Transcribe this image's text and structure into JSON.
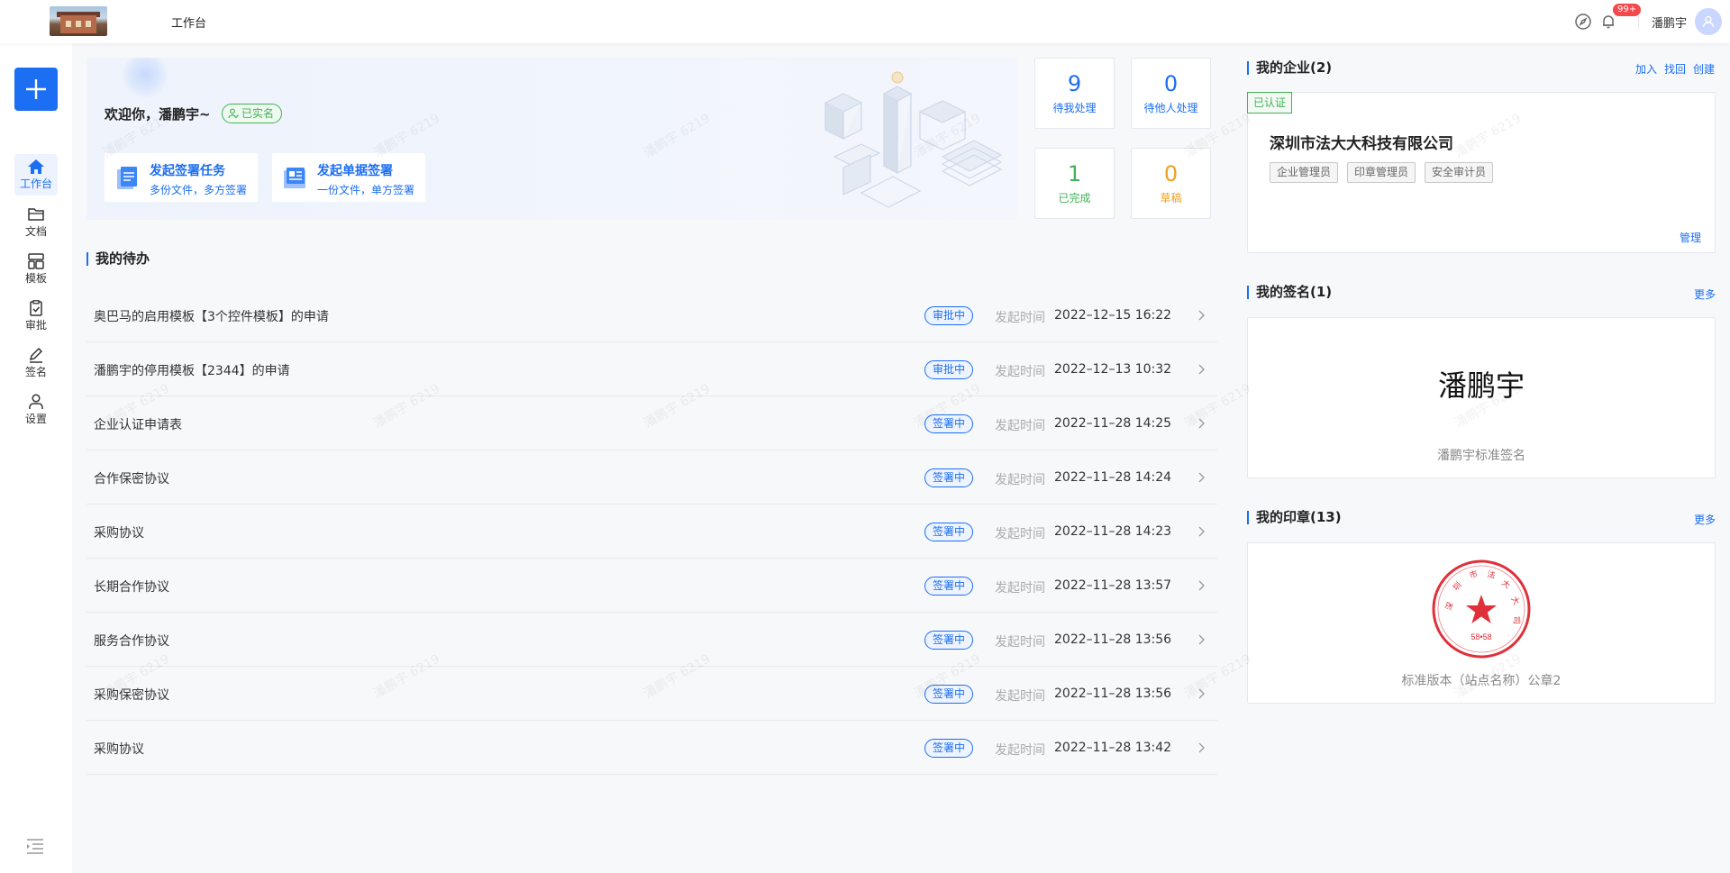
{
  "header": {
    "title": "工作台",
    "notification_badge": "99+",
    "username": "潘鹏宇"
  },
  "sidebar": {
    "items": [
      {
        "label": "工作台",
        "icon": "home-icon",
        "active": true
      },
      {
        "label": "文档",
        "icon": "folder-icon"
      },
      {
        "label": "模板",
        "icon": "template-icon"
      },
      {
        "label": "审批",
        "icon": "approval-icon"
      },
      {
        "label": "签名",
        "icon": "pen-icon"
      },
      {
        "label": "设置",
        "icon": "user-settings-icon"
      }
    ]
  },
  "banner": {
    "welcome": "欢迎你，潘鹏宇~",
    "verified": "已实名",
    "actions": [
      {
        "title": "发起签署任务",
        "subtitle": "多份文件，多方签署"
      },
      {
        "title": "发起单据签署",
        "subtitle": "一份文件，单方签署"
      }
    ]
  },
  "stats": [
    {
      "value": "9",
      "label": "待我处理",
      "color": "#1c6ef2"
    },
    {
      "value": "0",
      "label": "待他人处理",
      "color": "#1c6ef2"
    },
    {
      "value": "1",
      "label": "已完成",
      "color": "#43b257"
    },
    {
      "value": "0",
      "label": "草稿",
      "color": "#f0a020"
    }
  ],
  "todo": {
    "title": "我的待办",
    "time_label": "发起时间",
    "items": [
      {
        "name": "奥巴马的启用模板【3个控件模板】的申请",
        "status": "审批中",
        "time": "2022–12–15 16:22"
      },
      {
        "name": "潘鹏宇的停用模板【2344】的申请",
        "status": "审批中",
        "time": "2022–12–13 10:32"
      },
      {
        "name": "企业认证申请表",
        "status": "签署中",
        "time": "2022–11–28 14:25"
      },
      {
        "name": "合作保密协议",
        "status": "签署中",
        "time": "2022–11–28 14:24"
      },
      {
        "name": "采购协议",
        "status": "签署中",
        "time": "2022–11–28 14:23"
      },
      {
        "name": "长期合作协议",
        "status": "签署中",
        "time": "2022–11–28 13:57"
      },
      {
        "name": "服务合作协议",
        "status": "签署中",
        "time": "2022–11–28 13:56"
      },
      {
        "name": "采购保密协议",
        "status": "签署中",
        "time": "2022–11–28 13:56"
      },
      {
        "name": "采购协议",
        "status": "签署中",
        "time": "2022–11–28 13:42"
      }
    ]
  },
  "enterprise": {
    "title": "我的企业(2)",
    "links": [
      "加入",
      "找回",
      "创建"
    ],
    "cert": "已认证",
    "company": "深圳市法大大科技有限公司",
    "roles": [
      "企业管理员",
      "印章管理员",
      "安全审计员"
    ],
    "manage": "管理"
  },
  "signature": {
    "title": "我的签名(1)",
    "more": "更多",
    "name": "潘鹏宇",
    "caption": "潘鹏宇标准签名"
  },
  "seal": {
    "title": "我的印章(13)",
    "more": "更多",
    "caption": "标准版本（站点名称）公章2",
    "code": "58•58"
  },
  "watermark": "潘鹏宇 6219"
}
